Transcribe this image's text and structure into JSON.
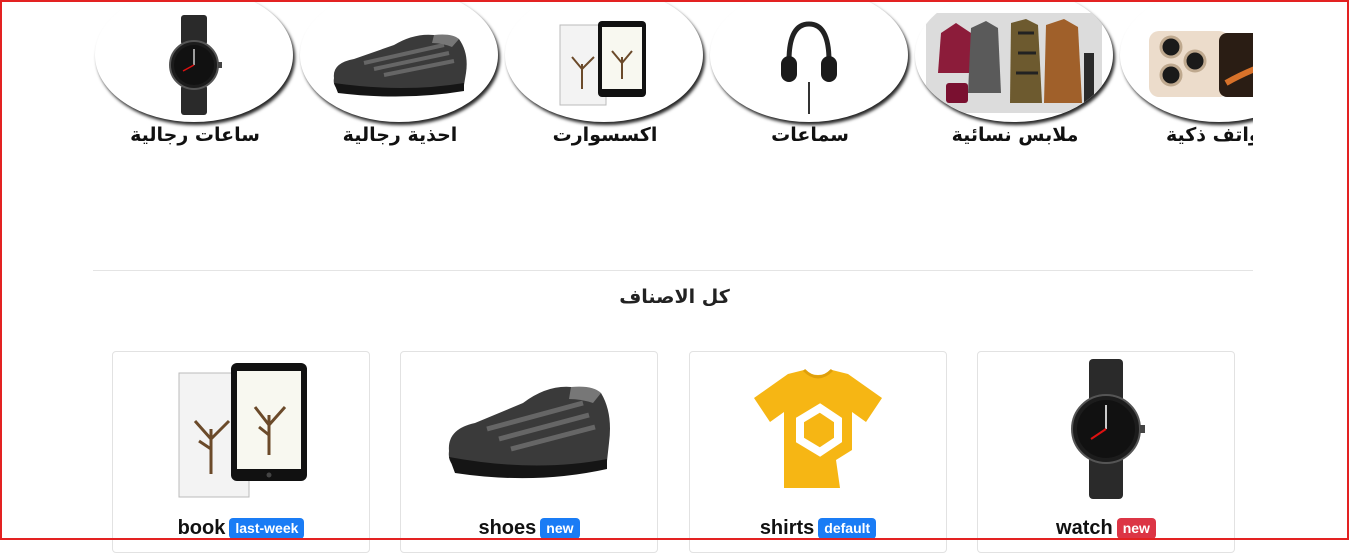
{
  "categories": [
    {
      "label": "ساعات رجالية",
      "icon": "watch-image"
    },
    {
      "label": "احذية رجالية",
      "icon": "shoe-image"
    },
    {
      "label": "اكسسوارت",
      "icon": "book-image"
    },
    {
      "label": "سماعات",
      "icon": "headphones-image"
    },
    {
      "label": "ملابس نسائية",
      "icon": "womens-clothes-image"
    },
    {
      "label": "هواتف ذكية",
      "icon": "smartphone-image"
    }
  ],
  "section": {
    "title": "كل الاصناف"
  },
  "products": [
    {
      "name": "book",
      "badge": "last-week",
      "badge_color": "#1a7cf5",
      "icon": "book-image"
    },
    {
      "name": "shoes",
      "badge": "new",
      "badge_color": "#1a7cf5",
      "icon": "shoe-image"
    },
    {
      "name": "shirts",
      "badge": "default",
      "badge_color": "#1a7cf5",
      "icon": "tshirt-image"
    },
    {
      "name": "watch",
      "badge": "new",
      "badge_color": "#dc3545",
      "icon": "watch-image"
    }
  ]
}
